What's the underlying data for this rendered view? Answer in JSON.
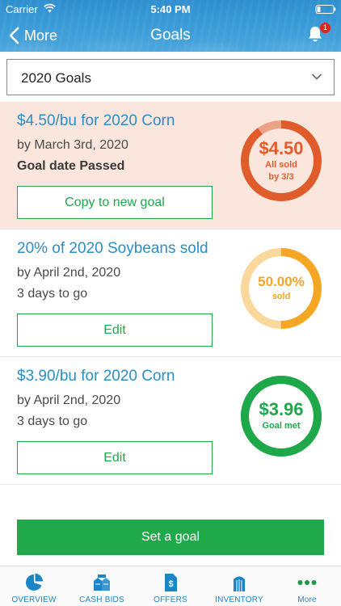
{
  "status_bar": {
    "carrier": "Carrier",
    "time": "5:40 PM"
  },
  "nav": {
    "back_label": "More",
    "title": "Goals",
    "notification_count": "1"
  },
  "selector": {
    "value": "2020 Goals"
  },
  "goals": [
    {
      "title": "$4.50/bu for 2020 Corn",
      "date": "by March 3rd, 2020",
      "status": "Goal date Passed",
      "button_label": "Copy to new goal",
      "ring_main": "$4.50",
      "ring_sub_1": "All sold",
      "ring_sub_2": "by 3/3",
      "ring_color": "#e05c2a",
      "ring_track_color": "#eca287",
      "ring_fill": 0.9
    },
    {
      "title": "20% of 2020 Soybeans sold",
      "date": "by April 2nd, 2020",
      "status": "3 days to go",
      "button_label": "Edit",
      "ring_main": "50.00%",
      "ring_sub_1": "sold",
      "ring_color": "#f5a623",
      "ring_track_color": "#fad79a",
      "ring_fill": 0.5
    },
    {
      "title": "$3.90/bu for 2020 Corn",
      "date": "by April 2nd, 2020",
      "status": "3 days to go",
      "button_label": "Edit",
      "ring_main": "$3.96",
      "ring_sub_1": "Goal met",
      "ring_color": "#1ea84a",
      "ring_track_color": "#1ea84a",
      "ring_fill": 1.0
    }
  ],
  "set_goal_label": "Set a goal",
  "tabs": [
    {
      "label": "OVERVIEW",
      "icon": "pie-chart-icon"
    },
    {
      "label": "CASH BIDS",
      "icon": "grain-bins-icon"
    },
    {
      "label": "OFFERS",
      "icon": "document-dollar-icon"
    },
    {
      "label": "INVENTORY",
      "icon": "silo-icon"
    },
    {
      "label": "More",
      "icon": "more-dots-icon"
    }
  ],
  "colors": {
    "accent_blue": "#2a8ec7",
    "green": "#1fa94b",
    "header": "#3a9ad6",
    "passed_bg": "#fbe6dd"
  }
}
